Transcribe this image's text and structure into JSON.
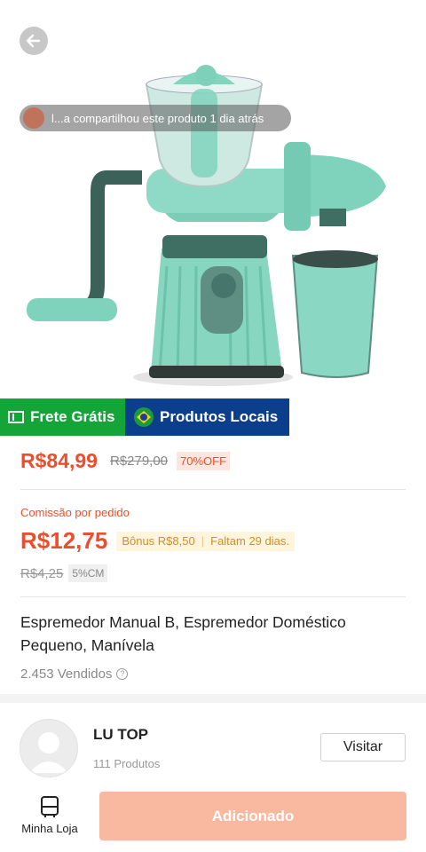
{
  "hero": {
    "share_toast": "l...a compartilhou este produto 1 dia atrás"
  },
  "badges": {
    "frete": "Frete Grátis",
    "local": "Produtos Locais"
  },
  "pricing": {
    "price": "R$84,99",
    "original_price": "R$279,00",
    "discount": "70%OFF"
  },
  "commission": {
    "label": "Comissão por pedido",
    "value": "R$12,75",
    "bonus": "Bônus R$8,50",
    "deadline": "Faltam 29 dias.",
    "old_value": "R$4,25",
    "rate": "5%CM"
  },
  "product": {
    "title": "Espremedor Manual B, Espremedor Doméstico Pequeno, Manívela",
    "sold": "2.453 Vendidos"
  },
  "store": {
    "name": "LU TOP",
    "products": "111 Produtos",
    "visit_label": "Visitar"
  },
  "bottom": {
    "my_store": "Minha Loja",
    "added": "Adicionado"
  },
  "colors": {
    "accent": "#ee4d2d",
    "frete_green": "#13a538",
    "local_blue": "#0b3f8c",
    "product_teal": "#7fd3bd"
  }
}
